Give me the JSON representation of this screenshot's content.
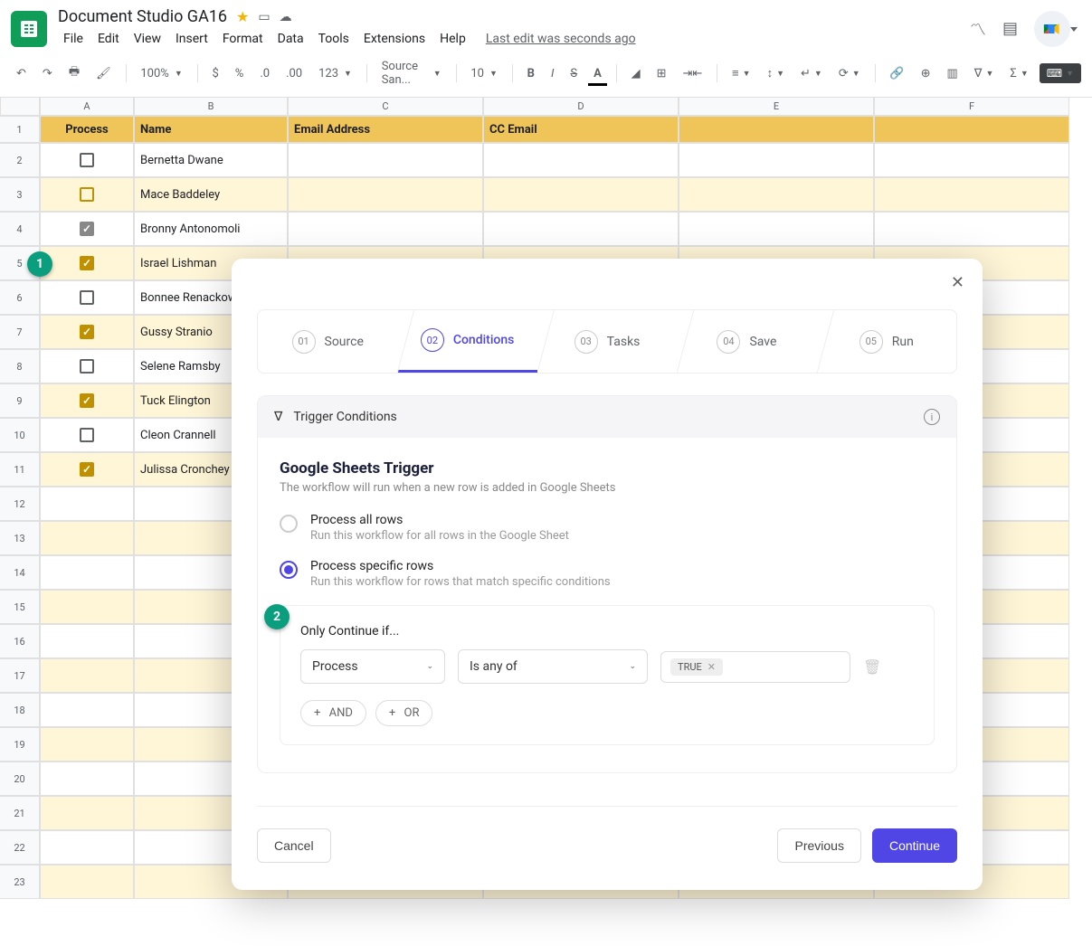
{
  "doc_title": "Document Studio GA16",
  "last_edit": "Last edit was seconds ago",
  "menu": {
    "file": "File",
    "edit": "Edit",
    "view": "View",
    "insert": "Insert",
    "format": "Format",
    "data": "Data",
    "tools": "Tools",
    "extensions": "Extensions",
    "help": "Help"
  },
  "toolbar": {
    "zoom": "100%",
    "font": "Source San...",
    "size": "10",
    "numfmt": "123"
  },
  "columns": [
    "A",
    "B",
    "C",
    "D",
    "E",
    "F"
  ],
  "headers": {
    "A": "Process",
    "B": "Name",
    "C": "Email Address",
    "D": "CC Email",
    "E": "",
    "F": ""
  },
  "rows": [
    {
      "num": "1"
    },
    {
      "num": "2",
      "checked": "empty",
      "name": "Bernetta Dwane"
    },
    {
      "num": "3",
      "checked": "outline-gold",
      "name": "Mace Baddeley",
      "stripe": true
    },
    {
      "num": "4",
      "checked": "gray-checked",
      "name": "Bronny Antonomoli"
    },
    {
      "num": "5",
      "checked": "checked",
      "name": "Israel Lishman",
      "stripe": true
    },
    {
      "num": "6",
      "checked": "empty",
      "name": "Bonnee Renackowna"
    },
    {
      "num": "7",
      "checked": "checked",
      "name": "Gussy Stranio",
      "stripe": true
    },
    {
      "num": "8",
      "checked": "empty",
      "name": "Selene Ramsby"
    },
    {
      "num": "9",
      "checked": "checked",
      "name": "Tuck Elington",
      "stripe": true
    },
    {
      "num": "10",
      "checked": "empty",
      "name": "Cleon Crannell"
    },
    {
      "num": "11",
      "checked": "checked",
      "name": "Julissa Cronchey",
      "stripe": true
    },
    {
      "num": "12",
      "stripe": false
    },
    {
      "num": "13",
      "stripe": true
    },
    {
      "num": "14"
    },
    {
      "num": "15",
      "stripe": true
    },
    {
      "num": "16"
    },
    {
      "num": "17",
      "stripe": true
    },
    {
      "num": "18"
    },
    {
      "num": "19",
      "stripe": true
    },
    {
      "num": "20"
    },
    {
      "num": "21",
      "stripe": true
    },
    {
      "num": "22"
    },
    {
      "num": "23",
      "stripe": true
    }
  ],
  "annotations": {
    "a1": "1",
    "a2": "2"
  },
  "steps": [
    {
      "num": "01",
      "label": "Source"
    },
    {
      "num": "02",
      "label": "Conditions",
      "active": true
    },
    {
      "num": "03",
      "label": "Tasks"
    },
    {
      "num": "04",
      "label": "Save"
    },
    {
      "num": "05",
      "label": "Run"
    }
  ],
  "panel": {
    "head": "Trigger Conditions",
    "title": "Google Sheets Trigger",
    "sub": "The workflow will run when a new row is added in Google Sheets",
    "opt1_title": "Process all rows",
    "opt1_sub": "Run this workflow for all rows in the Google Sheet",
    "opt2_title": "Process specific rows",
    "opt2_sub": "Run this workflow for rows that match specific conditions",
    "cond_title": "Only Continue if...",
    "field": "Process",
    "op": "Is any of",
    "tag": "TRUE",
    "and": "AND",
    "or": "OR"
  },
  "footer": {
    "cancel": "Cancel",
    "prev": "Previous",
    "cont": "Continue"
  }
}
